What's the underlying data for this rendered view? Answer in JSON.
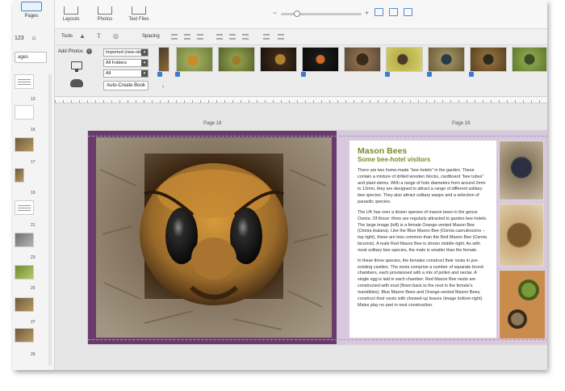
{
  "window": {
    "title": ""
  },
  "left_panel": {
    "pages_tab": "Pages",
    "counter": "123",
    "pages_select": "ages",
    "page_numbers": [
      "13",
      "15",
      "17",
      "19",
      "21",
      "23",
      "25",
      "27",
      "29"
    ]
  },
  "toolbar": {
    "layouts_label": "Layouts",
    "photos_label": "Photos",
    "text_files_label": "Text Files",
    "zoom_minus": "−",
    "zoom_plus": "+"
  },
  "tools_row": {
    "tools_label": "Tools",
    "spacing_label": "Spacing"
  },
  "photos_panel": {
    "add_photos_label": "Add Photos",
    "filter_imported": "Imported (new-old)",
    "filter_folders": "All Folders",
    "filter_all": "All",
    "auto_create_label": "Auto-Create Book",
    "collapse_glyph": "‹"
  },
  "canvas": {
    "left_page_label": "Page 18",
    "right_page_label": "Page 19"
  },
  "article": {
    "title": "Mason Bees",
    "subtitle": "Some bee-hotel visitors",
    "paragraphs": [
      "There are two home-made “bee-hotels” in the garden. These contain a mixture of drilled wooden blocks, cardboard “bee tubes” and plant stems. With a range of hole diameters from around 2mm to 12mm, they are designed to attract a range of different solitary bee species. They also attract solitary wasps and a selection of parasitic species.",
      "The UK has over a dozen species of mason bees in the genus Osmia. Of those: three are regularly attracted to garden bee-hotels. The large image (left) is a female Orange-vented Mason Bee (Osmia leaiana). Like the Blue Mason Bee (Osmia caerulescens – top right), these are less common than the Red Mason Bee (Osmia bicornis). A male Red Mason Bee is shown middle-right. As with most solitary bee species, the male is smaller than the female.",
      "In these three species, the females construct their nests in pre-existing cavities. The nests comprise a number of separate brood chambers, each provisioned with a mix of pollen and nectar. A single egg is laid in each chamber. Red Mason Bee nests are constructed with mud (flown back to the nest in the female’s mandibles). Blue Mason Bees and Orange-vented Mason Bees, construct their nests with chewed-up leaves (image bottom-right). Males play no part in nest construction."
    ]
  },
  "colors": {
    "accent_green": "#7a8c2a",
    "frame_purple": "#6a3b6a",
    "page_lilac": "#d9c7dd",
    "select_blue": "#3a7bd5"
  }
}
